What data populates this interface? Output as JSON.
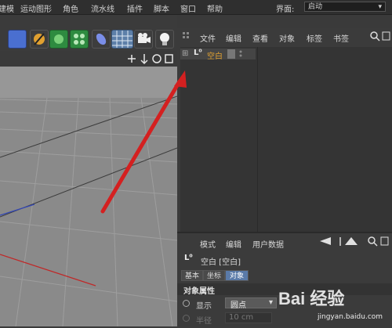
{
  "menubar": {
    "items": [
      "建模",
      "运动图形",
      "角色",
      "流水线",
      "插件",
      "脚本",
      "窗口",
      "帮助"
    ],
    "layout_label": "界面:",
    "layout_value": "启动"
  },
  "toolbar": {
    "tools": [
      "cube-primitive",
      "pen-spline",
      "nurbs-generator",
      "array-generator",
      "deformer",
      "floor-scene",
      "camera",
      "light"
    ]
  },
  "object_manager": {
    "menu": [
      "文件",
      "编辑",
      "查看",
      "对象",
      "标签",
      "书签"
    ],
    "objects": [
      {
        "name": "空白",
        "icon": "null-object-icon"
      }
    ]
  },
  "attribute_manager": {
    "menu": [
      "模式",
      "编辑",
      "用户数据"
    ],
    "object_title": "空白 [空白]",
    "tabs": [
      "基本",
      "坐标",
      "对象"
    ],
    "active_tab": "对象",
    "section_title": "对象属性",
    "display_label": "显示",
    "display_value": "圆点",
    "radius_label": "半径",
    "radius_value": "10 cm"
  },
  "watermark": {
    "text": "Bai 经验",
    "url": "jingyan.baidu.com"
  },
  "colors": {
    "accent": "#e0a030",
    "arrow": "#d42020",
    "viewport": "#8a8a8a"
  }
}
